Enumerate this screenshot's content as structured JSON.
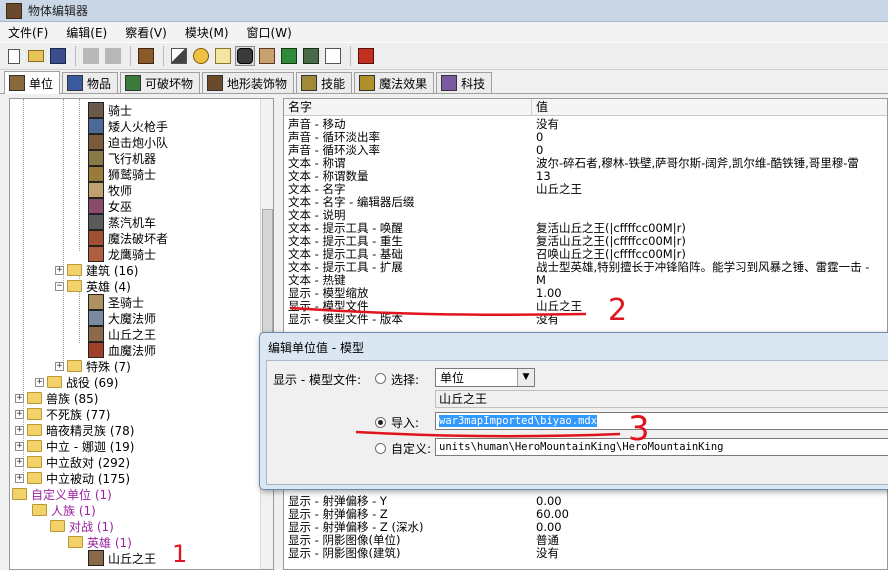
{
  "window": {
    "title": "物体编辑器"
  },
  "menu": [
    "文件(F)",
    "编辑(E)",
    "察看(V)",
    "模块(M)",
    "窗口(W)"
  ],
  "tabs": [
    {
      "label": "单位",
      "active": true,
      "icon": "unit-icon"
    },
    {
      "label": "物品",
      "active": false,
      "icon": "item-icon"
    },
    {
      "label": "可破坏物",
      "active": false,
      "icon": "destructible-icon"
    },
    {
      "label": "地形装饰物",
      "active": false,
      "icon": "doodad-icon"
    },
    {
      "label": "技能",
      "active": false,
      "icon": "ability-icon"
    },
    {
      "label": "魔法效果",
      "active": false,
      "icon": "buff-icon"
    },
    {
      "label": "科技",
      "active": false,
      "icon": "upgrade-icon"
    }
  ],
  "tree": {
    "units": [
      "骑士",
      "矮人火枪手",
      "迫击炮小队",
      "飞行机器",
      "狮鹫骑士",
      "牧师",
      "女巫",
      "蒸汽机车",
      "魔法破坏者",
      "龙鹰骑士"
    ],
    "building": "建筑 (16)",
    "heroes_folder": "英雄 (4)",
    "heroes": [
      "圣骑士",
      "大魔法师",
      "山丘之王",
      "血魔法师"
    ],
    "special": "特殊 (7)",
    "campaign": "战役 (69)",
    "races": [
      "兽族 (85)",
      "不死族 (77)",
      "暗夜精灵族 (78)",
      "中立 - 娜迦 (19)",
      "中立敌对 (292)",
      "中立被动 (175)"
    ],
    "custom_root": "自定义单位 (1)",
    "custom_human": "人族 (1)",
    "custom_melee": "对战 (1)",
    "custom_heroes": "英雄 (1)",
    "custom_unit": "山丘之王"
  },
  "grid": {
    "headers": [
      "名字",
      "值"
    ],
    "rows_top": [
      [
        "声音 - 移动",
        "没有"
      ],
      [
        "声音 - 循环淡出率",
        "0"
      ],
      [
        "声音 - 循环淡入率",
        "0"
      ],
      [
        "文本 - 称谓",
        "波尔-碎石者,穆林-铁壁,萨哥尔斯-阔斧,凯尔维-酷铁锤,哥里穆-雷"
      ],
      [
        "文本 - 称谓数量",
        "13"
      ],
      [
        "文本 - 名字",
        "山丘之王"
      ],
      [
        "文本 - 名字 - 编辑器后缀",
        ""
      ],
      [
        "文本 - 说明",
        ""
      ],
      [
        "文本 - 提示工具 - 唤醒",
        "复活山丘之王(|cffffcc00M|r)"
      ],
      [
        "文本 - 提示工具 - 重生",
        "复活山丘之王(|cffffcc00M|r)"
      ],
      [
        "文本 - 提示工具 - 基础",
        "召唤山丘之王(|cffffcc00M|r)"
      ],
      [
        "文本 - 提示工具 - 扩展",
        "战士型英雄,特别擅长于冲锋陷阵。能学习到风暴之锤、雷霆一击 -"
      ],
      [
        "文本 - 热键",
        "M"
      ],
      [
        "显示 - 模型缩放",
        "1.00"
      ],
      [
        "显示 - 模型文件",
        "山丘之王"
      ],
      [
        "显示 - 模型文件 - 版本",
        "没有"
      ]
    ],
    "rows_bottom": [
      [
        "显示 - 射弹偏移 - Y",
        "0.00"
      ],
      [
        "显示 - 射弹偏移 - Z",
        "60.00"
      ],
      [
        "显示 - 射弹偏移 - Z (深水)",
        "0.00"
      ],
      [
        "显示 - 阴影图像(单位)",
        "普通"
      ],
      [
        "显示 - 阴影图像(建筑)",
        "没有"
      ]
    ]
  },
  "dialog": {
    "title": "编辑单位值 - 模型",
    "field_label": "显示 - 模型文件:",
    "option_select": "选择:",
    "select_value": "单位",
    "select_display": "山丘之王",
    "option_import": "导入:",
    "import_value": "war3mapImported\\biyao.mdx",
    "option_custom": "自定义:",
    "custom_value": "units\\human\\HeroMountainKing\\HeroMountainKing",
    "selected_option": "import"
  },
  "annotations": [
    "1",
    "2",
    "3"
  ],
  "colors": {
    "custom_tree": "#9b1fa0",
    "annotation": "#e0141e",
    "selection": "#3399ff"
  }
}
